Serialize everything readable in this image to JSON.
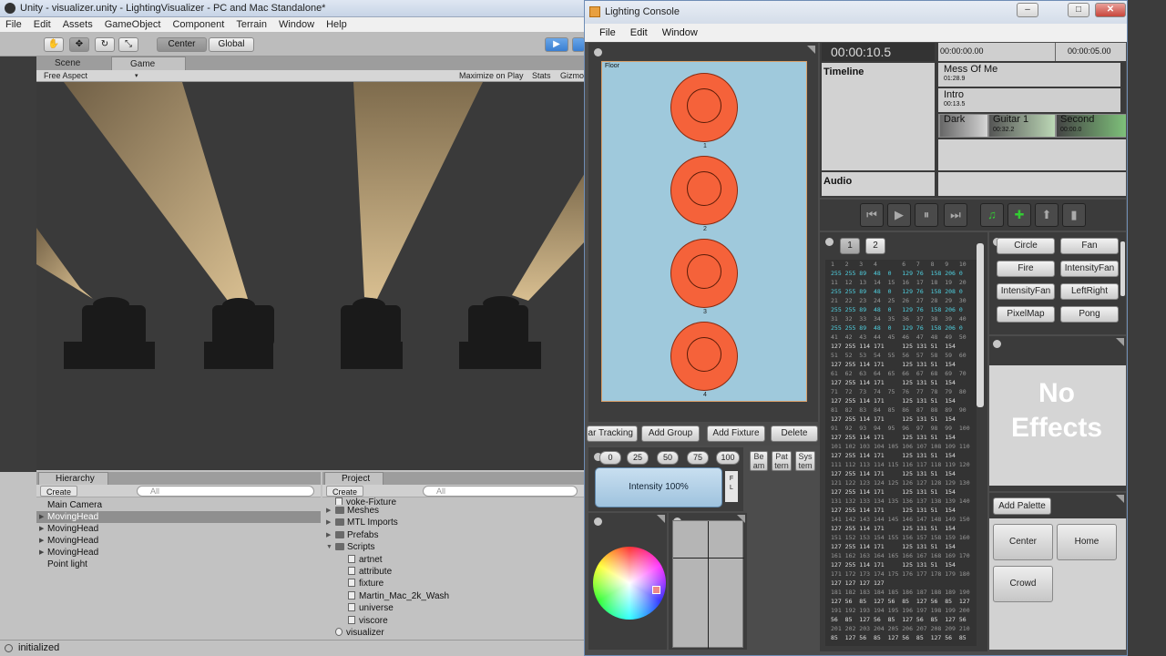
{
  "unity": {
    "title": "Unity - visualizer.unity - LightingVisualizer - PC and Mac Standalone*",
    "menu": [
      "File",
      "Edit",
      "Assets",
      "GameObject",
      "Component",
      "Terrain",
      "Window",
      "Help"
    ],
    "toolbar": {
      "pivot": "Center",
      "space": "Global"
    },
    "tabs": {
      "scene": "Scene",
      "game": "Game"
    },
    "gamebar": {
      "aspect": "Free Aspect",
      "maximize": "Maximize on Play",
      "stats": "Stats",
      "gizmos": "Gizmo"
    },
    "hierarchy": {
      "tab": "Hierarchy",
      "create": "Create",
      "search_placeholder": "All",
      "items": [
        "Main Camera",
        "MovingHead",
        "MovingHead",
        "MovingHead",
        "MovingHead",
        "Point light"
      ]
    },
    "project": {
      "tab": "Project",
      "create": "Create",
      "search_placeholder": "All",
      "items": [
        "yoke-Fixture",
        "Meshes",
        "MTL Imports",
        "Prefabs",
        "Scripts",
        "artnet",
        "attribute",
        "fixture",
        "Martin_Mac_2k_Wash",
        "universe",
        "viscore",
        "visualizer"
      ]
    },
    "status": "initialized"
  },
  "console": {
    "title": "Lighting Console",
    "menu": [
      "File",
      "Edit",
      "Window"
    ],
    "floor": {
      "label": "Floor",
      "fixtures": [
        "1",
        "2",
        "3",
        "4"
      ]
    },
    "fixture_buttons": [
      "ar Tracking",
      "Add Group",
      "Add Fixture",
      "Delete"
    ],
    "intensity_presets": [
      "0",
      "25",
      "50",
      "75",
      "100"
    ],
    "intensity_label": "Intensity 100%",
    "fl_label": "F\nL",
    "side_buttons": [
      "Be\nam",
      "Pat\ntern",
      "Sys\ntem"
    ],
    "timeline": {
      "time": "00:00:10.5",
      "ruler_start": "00:00:00.00",
      "ruler_end": "00:00:05.00",
      "label": "Timeline",
      "audio_label": "Audio",
      "tracks": [
        {
          "name": "Mess Of Me",
          "duration": "01:28.9"
        },
        {
          "name": "Intro",
          "duration": "00:13.5"
        }
      ],
      "segments": [
        {
          "name": "Dark",
          "time": ""
        },
        {
          "name": "Guitar 1",
          "time": "00:32.2"
        },
        {
          "name": "Second",
          "time": "00:00.0"
        }
      ]
    },
    "universe_tabs": [
      "1",
      "2"
    ],
    "dmx_rows": [
      "1   2   3   4       6   7   8   9   10",
      "255 255 89  48  0   129 76  158 206 0",
      "11  12  13  14  15  16  17  18  19  20",
      "255 255 89  48  0   129 76  158 208 0",
      "21  22  23  24  25  26  27  28  29  30",
      "255 255 89  48  0   129 76  158 206 0",
      "31  32  33  34  35  36  37  38  39  40",
      "255 255 89  48  0   129 76  158 206 0",
      "41  42  43  44  45  46  47  48  49  50",
      "127 255 114 171     125 131 51  154",
      "51  52  53  54  55  56  57  58  59  60",
      "127 255 114 171     125 131 51  154",
      "61  62  63  64  65  66  67  68  69  70",
      "127 255 114 171     125 131 51  154",
      "71  72  73  74  75  76  77  78  79  80",
      "127 255 114 171     125 131 51  154",
      "81  82  83  84  85  86  87  88  89  90",
      "127 255 114 171     125 131 51  154",
      "91  92  93  94  95  96  97  98  99  100",
      "127 255 114 171     125 131 51  154",
      "101 102 103 104 105 106 107 108 109 110",
      "127 255 114 171     125 131 51  154",
      "111 112 113 114 115 116 117 118 119 120",
      "127 255 114 171     125 131 51  154",
      "121 122 123 124 125 126 127 128 129 130",
      "127 255 114 171     125 131 51  154",
      "131 132 133 134 135 136 137 138 139 140",
      "127 255 114 171     125 131 51  154",
      "141 142 143 144 145 146 147 148 149 150",
      "127 255 114 171     125 131 51  154",
      "151 152 153 154 155 156 157 158 159 160",
      "127 255 114 171     125 131 51  154",
      "161 162 163 164 165 166 167 168 169 170",
      "127 255 114 171     125 131 51  154",
      "171 172 173 174 175 176 177 178 179 180",
      "127 127 127 127",
      "181 182 183 184 185 186 187 188 189 190",
      "127 56  85  127 56  85  127 56  85  127",
      "191 192 193 194 195 196 197 198 199 200",
      "56  85  127 56  85  127 56  85  127 56",
      "201 202 203 204 205 206 207 208 209 210",
      "85  127 56  85  127 56  85  127 56  85"
    ],
    "effects": [
      "Circle",
      "Fan",
      "Fire",
      "IntensityFan",
      "IntensityFan",
      "LeftRight",
      "PixelMap",
      "Pong"
    ],
    "no_effects": "No Effects",
    "add_palette": "Add Palette",
    "palettes": [
      "Center",
      "Home",
      "Crowd"
    ]
  }
}
